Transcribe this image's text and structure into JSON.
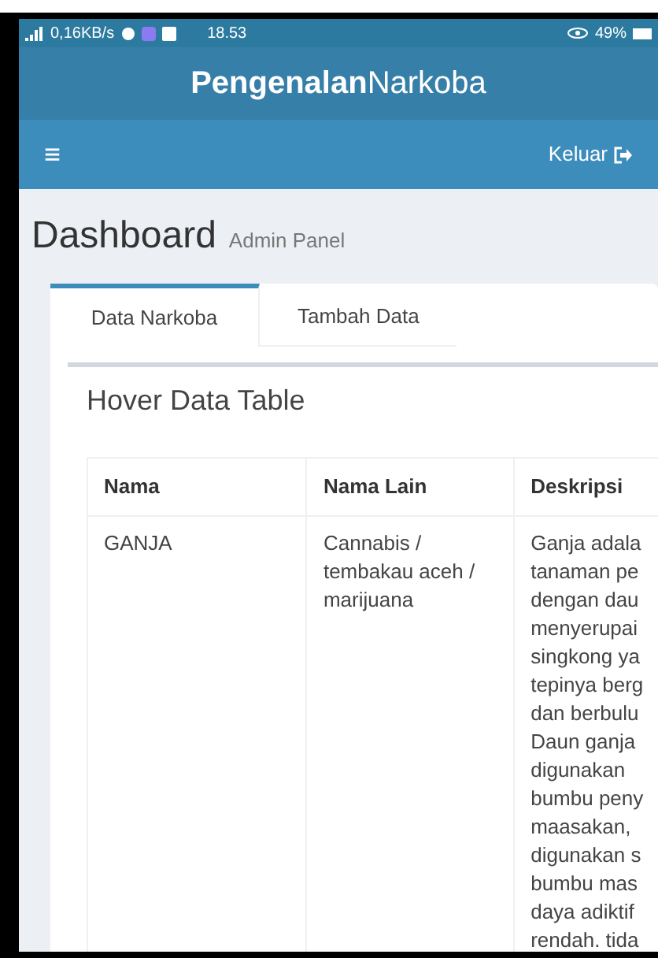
{
  "status_bar": {
    "speed": "0,16KB/s",
    "time": "18.53",
    "battery": "49%"
  },
  "app_header": {
    "title_bold": "Pengenalan",
    "title_light": "Narkoba"
  },
  "navbar": {
    "menu_icon": "≡",
    "logout": "Keluar"
  },
  "page": {
    "title": "Dashboard",
    "subtitle": "Admin Panel"
  },
  "tabs": [
    {
      "label": "Data Narkoba",
      "selected": true
    },
    {
      "label": "Tambah Data",
      "selected": false
    }
  ],
  "box": {
    "title": "Hover Data Table"
  },
  "table": {
    "columns": [
      "Nama",
      "Nama Lain",
      "Deskripsi"
    ],
    "rows": [
      {
        "nama": "GANJA",
        "nama_lain": "Cannabis / tembakau aceh / marijuana",
        "deskripsi_lines": [
          "Ganja adala",
          "tanaman pe",
          "dengan dau",
          "menyerupai",
          "singkong ya",
          "tepinya berg",
          "dan berbulu",
          "Daun ganja",
          "digunakan",
          "bumbu peny",
          "maasakan,",
          "digunakan s",
          "bumbu mas",
          "daya adiktif",
          "rendah. tida"
        ]
      }
    ]
  }
}
